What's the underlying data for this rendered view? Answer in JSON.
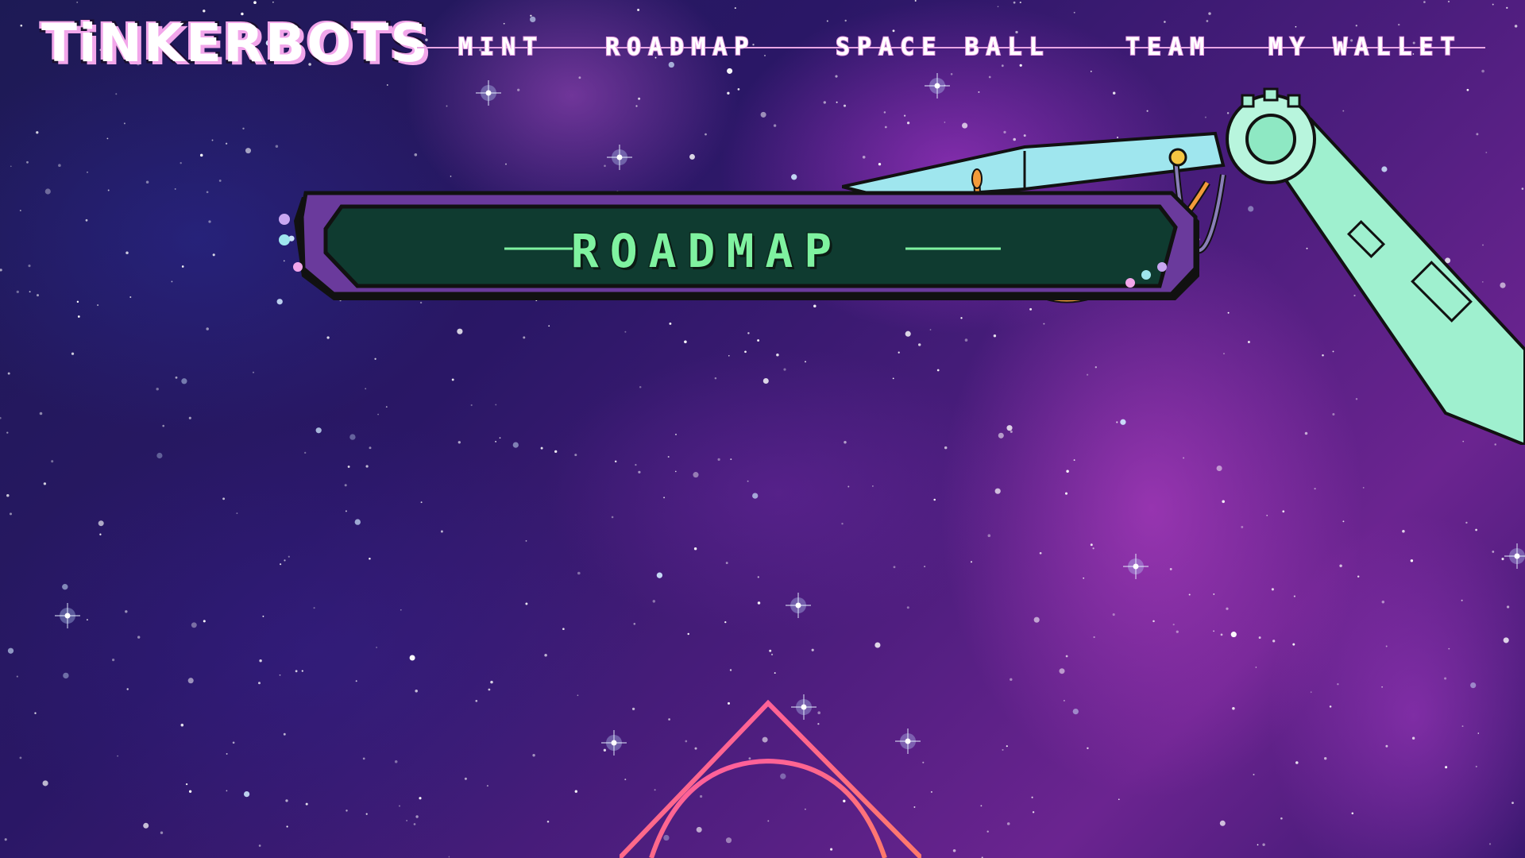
{
  "brand": {
    "logo_text": "TiNKERBOTS",
    "accent_pink": "#f2a6ea",
    "accent_green": "#7ff2a0",
    "banner_purple": "#6a3a9c",
    "banner_dark_green": "#0f3b30"
  },
  "nav": {
    "items": [
      {
        "label": "MINT"
      },
      {
        "label": "ROADMAP"
      },
      {
        "label": "SPACE BALL"
      },
      {
        "label": "TEAM"
      },
      {
        "label": "MY WALLET"
      }
    ]
  },
  "section": {
    "title": "ROADMAP"
  }
}
